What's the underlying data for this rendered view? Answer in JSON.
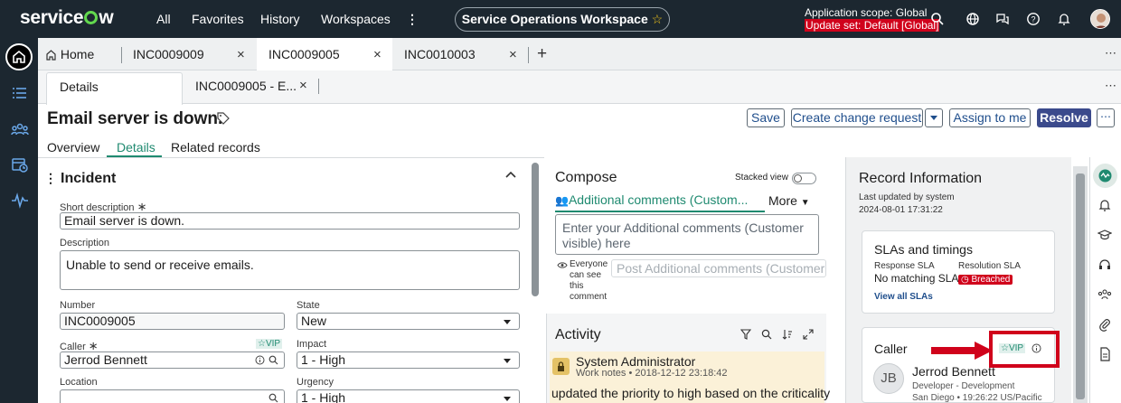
{
  "nav": {
    "logo": "servicenow",
    "menu": [
      "All",
      "Favorites",
      "History",
      "Workspaces"
    ],
    "workspace_name": "Service Operations Workspace",
    "scope_line1": "Application scope: Global",
    "scope_line2": "Update set: Default [Global]"
  },
  "tabs": [
    {
      "label": "Home"
    },
    {
      "label": "INC0009009"
    },
    {
      "label": "INC0009005"
    },
    {
      "label": "INC0010003"
    }
  ],
  "subtabs": [
    {
      "label": "Details"
    },
    {
      "label": "INC0009005 - E..."
    }
  ],
  "record": {
    "title": "Email server is down.",
    "buttons": {
      "save": "Save",
      "change": "Create change request",
      "assign": "Assign to me",
      "resolve": "Resolve"
    },
    "views": [
      "Overview",
      "Details",
      "Related records"
    ]
  },
  "incident": {
    "section_title": "Incident",
    "short_desc_label": "Short description",
    "short_desc": "Email server is down.",
    "desc_label": "Description",
    "desc": "Unable to send or receive emails.",
    "number_label": "Number",
    "number": "INC0009005",
    "state_label": "State",
    "state": "New",
    "caller_label": "Caller",
    "caller": "Jerrod Bennett",
    "vip": "VIP",
    "impact_label": "Impact",
    "impact": "1 - High",
    "location_label": "Location",
    "location": "",
    "urgency_label": "Urgency",
    "urgency": "1 - High",
    "required_mark": "∗"
  },
  "compose": {
    "title": "Compose",
    "stacked_view": "Stacked view",
    "tab_label": "Additional comments (Custom...",
    "more": "More",
    "placeholder": "Enter your Additional comments (Customer visible) here",
    "visibility": "Everyone can see this comment",
    "post_button": "Post Additional comments (Customer vi"
  },
  "activity": {
    "title": "Activity",
    "author": "System Administrator",
    "meta": "Work notes • 2018-12-12 23:18:42",
    "text": "updated the priority to high based on the criticality"
  },
  "record_info": {
    "title": "Record Information",
    "updated_by": "Last updated by system",
    "updated_at": "2024-08-01 17:31:22",
    "sla_title": "SLAs and timings",
    "response_label": "Response SLA",
    "response_value": "No matching SLA",
    "resolution_label": "Resolution SLA",
    "resolution_value": "Breached",
    "view_all": "View all SLAs",
    "caller_title": "Caller",
    "vip": "VIP",
    "initials": "JB",
    "caller_name": "Jerrod Bennett",
    "caller_role": "Developer - Development",
    "caller_loc": "San Diego • 19:26:22 US/Pacific"
  },
  "colors": {
    "nav_bg": "#1c2730",
    "accent": "#3b4a8c",
    "link": "#1f4e8c",
    "breach": "#d0021b",
    "annotation": "#d0021b",
    "scope_warning": "#ff2a2a",
    "active_green": "#1f8a70"
  }
}
